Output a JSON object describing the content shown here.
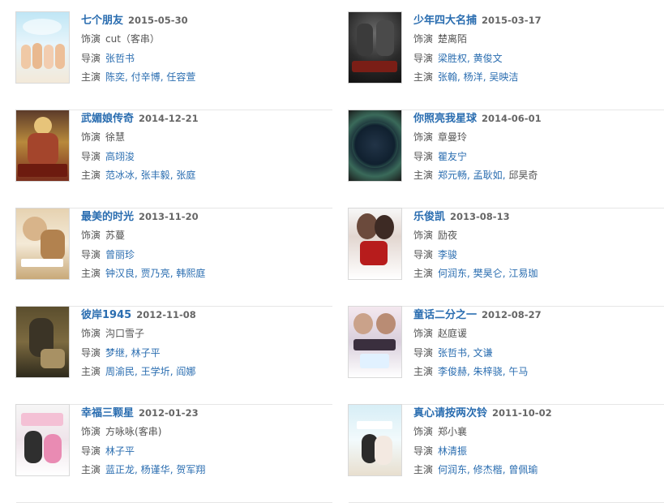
{
  "labels": {
    "actor_role": "饰演",
    "director": "导演",
    "starring": "主演"
  },
  "movies": [
    {
      "title": "七个朋友",
      "date": "2015-05-30",
      "role": "cut（客串）",
      "directors": [
        "张哲书"
      ],
      "stars": [
        "陈奕",
        "付辛博",
        "任容萱"
      ]
    },
    {
      "title": "少年四大名捕",
      "date": "2015-03-17",
      "role": "楚离陌",
      "directors": [
        "梁胜权",
        "黄俊文"
      ],
      "stars": [
        "张翰",
        "杨洋",
        "吴映洁"
      ]
    },
    {
      "title": "武媚娘传奇",
      "date": "2014-12-21",
      "role": "徐慧",
      "directors": [
        "高翊浚"
      ],
      "stars": [
        "范冰冰",
        "张丰毅",
        "张庭"
      ]
    },
    {
      "title": "你照亮我星球",
      "date": "2014-06-01",
      "role": "章曼玲",
      "directors": [
        "瞿友宁"
      ],
      "stars": [
        "郑元畅",
        "孟耿如",
        "邱昊奇"
      ]
    },
    {
      "title": "最美的时光",
      "date": "2013-11-20",
      "role": "苏蔓",
      "directors": [
        "曾丽珍"
      ],
      "stars": [
        "钟汉良",
        "贾乃亮",
        "韩熙庭"
      ]
    },
    {
      "title": "乐俊凯",
      "date": "2013-08-13",
      "role": "励夜",
      "directors": [
        "李骏"
      ],
      "stars": [
        "何润东",
        "樊昊仑",
        "江易珈"
      ]
    },
    {
      "title": "彼岸1945",
      "date": "2012-11-08",
      "role": "沟口雪子",
      "directors": [
        "梦继",
        "林子平"
      ],
      "stars": [
        "周渝民",
        "王学圻",
        "阎娜"
      ]
    },
    {
      "title": "童话二分之一",
      "date": "2012-08-27",
      "role": "赵庭谖",
      "directors": [
        "张哲书",
        "文谦"
      ],
      "stars": [
        "李俊赫",
        "朱梓骁",
        "午马"
      ]
    },
    {
      "title": "幸福三颗星",
      "date": "2012-01-23",
      "role": "方咏咏(客串)",
      "directors": [
        "林子平"
      ],
      "stars": [
        "蓝正龙",
        "杨谨华",
        "贺军翔"
      ]
    },
    {
      "title": "真心请按两次铃",
      "date": "2011-10-02",
      "role": "郑小襄",
      "directors": [
        "林清振"
      ],
      "stars": [
        "何润东",
        "修杰楷",
        "曾佩瑜"
      ]
    }
  ]
}
